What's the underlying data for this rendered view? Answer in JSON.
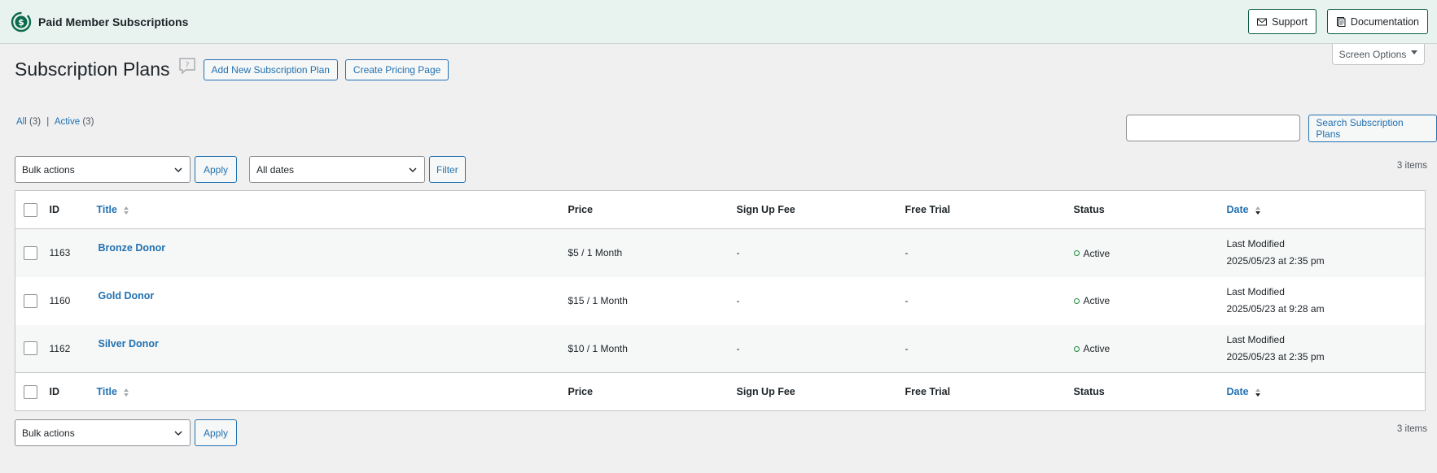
{
  "header": {
    "app_name": "Paid Member Subscriptions",
    "support_label": "Support",
    "documentation_label": "Documentation",
    "brand_color": "#0b6b4c"
  },
  "screen_options_label": "Screen Options",
  "page": {
    "title": "Subscription Plans",
    "add_new_label": "Add New Subscription Plan",
    "create_pricing_label": "Create Pricing Page"
  },
  "views": {
    "all_label": "All",
    "all_count": "(3)",
    "separator": "|",
    "active_label": "Active",
    "active_count": "(3)"
  },
  "search": {
    "button_label": "Search Subscription Plans",
    "value": ""
  },
  "top_nav": {
    "bulk_actions": "Bulk actions",
    "apply_label": "Apply",
    "dates_filter": "All dates",
    "filter_label": "Filter",
    "items_count": "3 items"
  },
  "table": {
    "columns": {
      "id": "ID",
      "title": "Title",
      "price": "Price",
      "signup_fee": "Sign Up Fee",
      "free_trial": "Free Trial",
      "status": "Status",
      "date": "Date"
    },
    "rows": [
      {
        "id": "1163",
        "title": "Bronze Donor",
        "price": "$5 / 1 Month",
        "signup_fee": "-",
        "free_trial": "-",
        "status": "Active",
        "date_label": "Last Modified",
        "date_value": "2025/05/23 at 2:35 pm"
      },
      {
        "id": "1160",
        "title": "Gold Donor",
        "price": "$15 / 1 Month",
        "signup_fee": "-",
        "free_trial": "-",
        "status": "Active",
        "date_label": "Last Modified",
        "date_value": "2025/05/23 at 9:28 am"
      },
      {
        "id": "1162",
        "title": "Silver Donor",
        "price": "$10 / 1 Month",
        "signup_fee": "-",
        "free_trial": "-",
        "status": "Active",
        "date_label": "Last Modified",
        "date_value": "2025/05/23 at 2:35 pm"
      }
    ]
  },
  "bottom_nav": {
    "bulk_actions": "Bulk actions",
    "apply_label": "Apply",
    "items_count": "3 items"
  }
}
